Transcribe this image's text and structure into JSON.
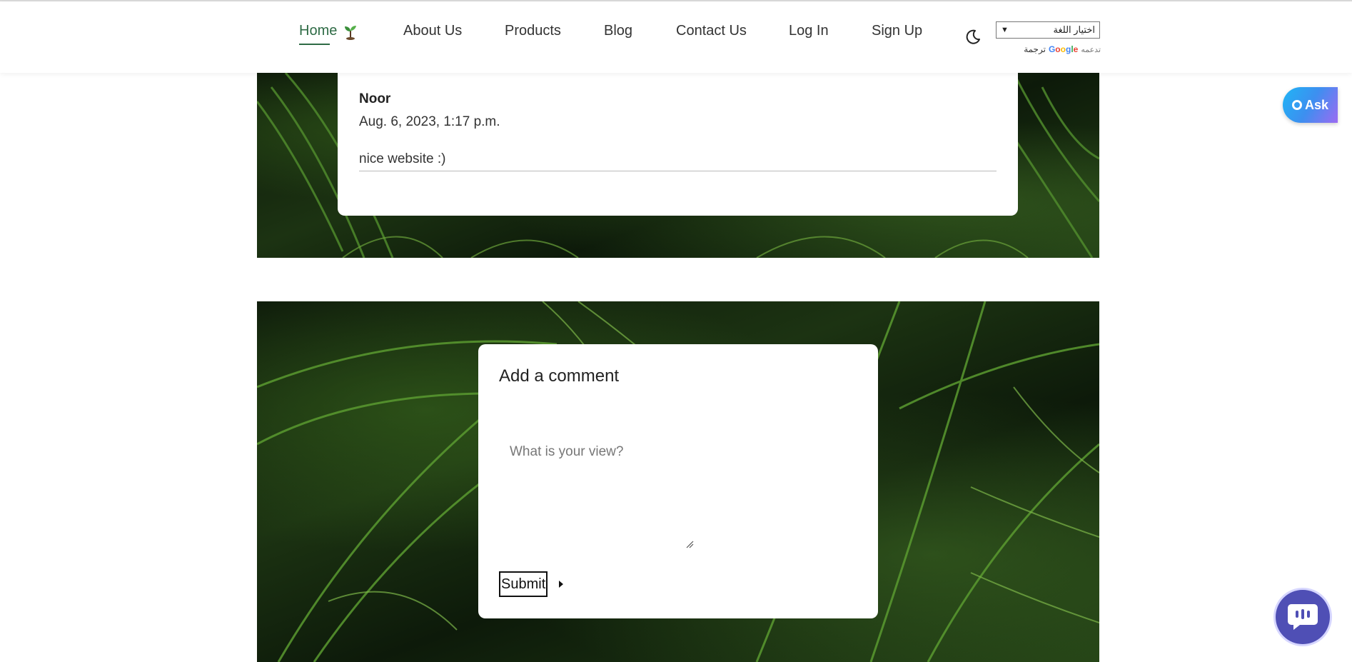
{
  "nav": {
    "items": [
      {
        "label": "Home",
        "active": true
      },
      {
        "label": "About Us"
      },
      {
        "label": "Products"
      },
      {
        "label": "Blog"
      },
      {
        "label": "Contact Us"
      },
      {
        "label": "Log In"
      },
      {
        "label": "Sign Up"
      }
    ],
    "icons": {
      "home": "sprout-icon",
      "theme": "moon-icon"
    }
  },
  "translate": {
    "select_label": "اختيار اللغة",
    "powered_by": "تدعمه",
    "google": [
      "G",
      "o",
      "o",
      "g",
      "l",
      "e"
    ],
    "translate_word": "ترجمة"
  },
  "comment": {
    "author": "Noor",
    "date": "Aug. 6, 2023, 1:17 p.m.",
    "body": "nice website :)"
  },
  "add_comment": {
    "title": "Add a comment",
    "placeholder": "What is your view?",
    "submit_label": "Submit"
  },
  "floating": {
    "ask_label": "Ask",
    "chat_icon": "chat-bubble-icon"
  },
  "colors": {
    "accent": "#2e6b45",
    "chat": "#4f4fb5",
    "ask_gradient": [
      "#1fb5f5",
      "#9c6bf2"
    ]
  }
}
